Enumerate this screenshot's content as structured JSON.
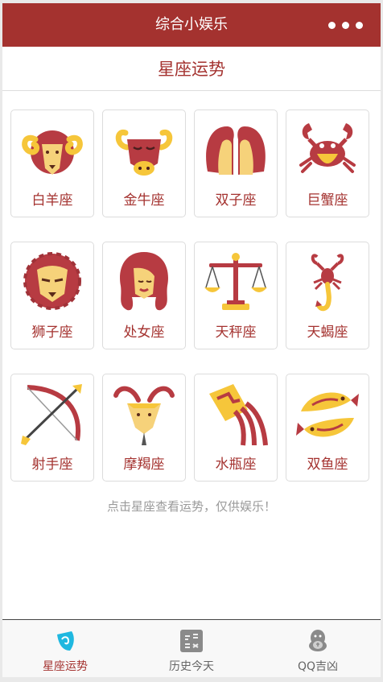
{
  "app": {
    "title": "综合小娱乐"
  },
  "header": {
    "title": "星座运势"
  },
  "signs": [
    {
      "id": "aries",
      "label": "白羊座",
      "icon": "ram-icon"
    },
    {
      "id": "taurus",
      "label": "金牛座",
      "icon": "bull-icon"
    },
    {
      "id": "gemini",
      "label": "双子座",
      "icon": "twins-icon"
    },
    {
      "id": "cancer",
      "label": "巨蟹座",
      "icon": "crab-icon"
    },
    {
      "id": "leo",
      "label": "狮子座",
      "icon": "lion-icon"
    },
    {
      "id": "virgo",
      "label": "处女座",
      "icon": "maiden-icon"
    },
    {
      "id": "libra",
      "label": "天秤座",
      "icon": "scales-icon"
    },
    {
      "id": "scorpio",
      "label": "天蝎座",
      "icon": "scorpion-icon"
    },
    {
      "id": "sagittarius",
      "label": "射手座",
      "icon": "bow-arrow-icon"
    },
    {
      "id": "capricorn",
      "label": "摩羯座",
      "icon": "goat-icon"
    },
    {
      "id": "aquarius",
      "label": "水瓶座",
      "icon": "water-vase-icon"
    },
    {
      "id": "pisces",
      "label": "双鱼座",
      "icon": "fishes-icon"
    }
  ],
  "hint": "点击星座查看运势，仅供娱乐！",
  "tabs": [
    {
      "label": "星座运势",
      "icon": "horoscope-icon",
      "active": true
    },
    {
      "label": "历史今天",
      "icon": "history-today-icon",
      "active": false
    },
    {
      "label": "QQ吉凶",
      "icon": "penguin-icon",
      "active": false
    }
  ],
  "colors": {
    "brand": "#a4322f",
    "accent_yellow": "#f6c63a",
    "icon_red": "#b73b42",
    "active_tab_icon": "#1fb8e0",
    "inactive_tab": "#666666",
    "hint": "#9a9a9a"
  }
}
